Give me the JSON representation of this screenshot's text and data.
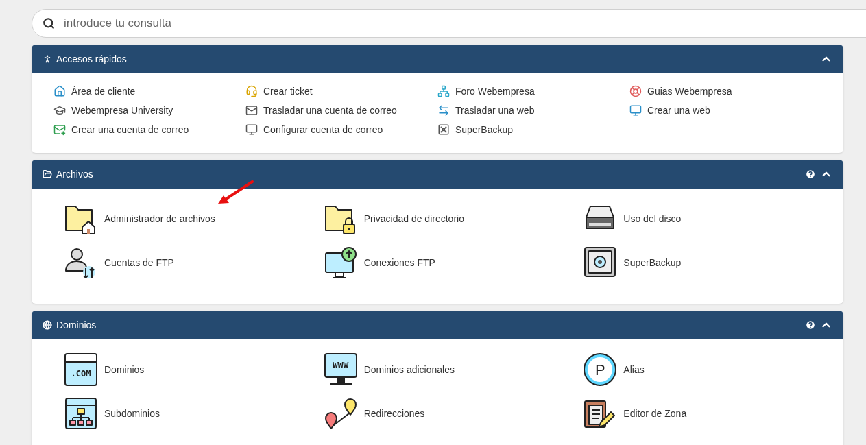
{
  "search": {
    "placeholder": "introduce tu consulta"
  },
  "sections": [
    {
      "title": "Accesos rápidos",
      "kind": "links",
      "help": false,
      "expanded": true,
      "items": [
        {
          "label": "Área de cliente"
        },
        {
          "label": "Crear ticket"
        },
        {
          "label": "Foro Webempresa"
        },
        {
          "label": "Guias Webempresa"
        },
        {
          "label": "Webempresa University"
        },
        {
          "label": "Trasladar una cuenta de correo"
        },
        {
          "label": "Trasladar una web"
        },
        {
          "label": "Crear una web"
        },
        {
          "label": "Crear una cuenta de correo"
        },
        {
          "label": "Configurar cuenta de correo"
        },
        {
          "label": "SuperBackup"
        }
      ]
    },
    {
      "title": "Archivos",
      "kind": "tools",
      "help": true,
      "expanded": true,
      "items": [
        {
          "label": "Administrador de archivos"
        },
        {
          "label": "Privacidad de directorio"
        },
        {
          "label": "Uso del disco"
        },
        {
          "label": "Cuentas de FTP"
        },
        {
          "label": "Conexiones FTP"
        },
        {
          "label": "SuperBackup"
        }
      ]
    },
    {
      "title": "Dominios",
      "kind": "tools",
      "help": true,
      "expanded": true,
      "items": [
        {
          "label": "Dominios",
          "icon_text": ".COM"
        },
        {
          "label": "Dominios adicionales",
          "icon_text": "WWW"
        },
        {
          "label": "Alias",
          "icon_text": "P"
        },
        {
          "label": "Subdominios"
        },
        {
          "label": "Redirecciones"
        },
        {
          "label": "Editor de Zona"
        }
      ]
    }
  ]
}
